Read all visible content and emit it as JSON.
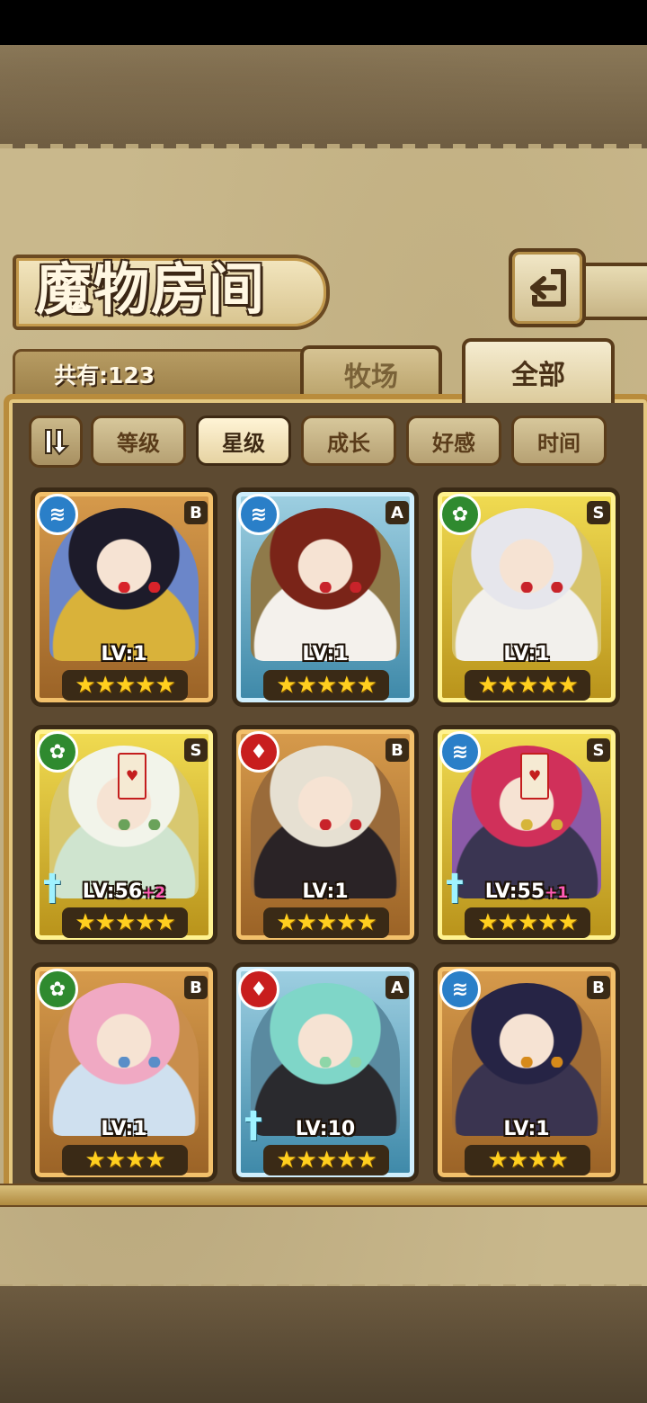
{
  "header": {
    "title": "魔物房间",
    "back_icon": "back-arrow-icon"
  },
  "summary": {
    "count_label": "共有:123"
  },
  "tabs": [
    {
      "label": "牧场",
      "active": false
    },
    {
      "label": "全部",
      "active": true
    }
  ],
  "sort": {
    "toggle_icon": "sort-order-icon",
    "buttons": [
      {
        "label": "等级",
        "active": false
      },
      {
        "label": "星级",
        "active": true
      },
      {
        "label": "成长",
        "active": false
      },
      {
        "label": "好感",
        "active": false
      },
      {
        "label": "时间",
        "active": false
      }
    ]
  },
  "cards": [
    {
      "element": "water",
      "rank": "B",
      "frame": "bronze",
      "level": "LV:1",
      "plus": "",
      "stars": 5,
      "hair": "#1d1b2a",
      "eye": "#d8232a",
      "cloth": "#d9b23a",
      "bg": "#6b86c9"
    },
    {
      "element": "water",
      "rank": "A",
      "frame": "silver",
      "level": "LV:1",
      "plus": "",
      "stars": 5,
      "hair": "#7a2418",
      "eye": "#c8232a",
      "cloth": "#f4f1ec",
      "bg": "#8f7a4a"
    },
    {
      "element": "grass",
      "rank": "S",
      "frame": "gold",
      "level": "LV:1",
      "plus": "",
      "stars": 5,
      "hair": "#e6e6ec",
      "eye": "#c8232a",
      "cloth": "#f2f0ec",
      "bg": "#d6c36c"
    },
    {
      "element": "grass",
      "rank": "S",
      "frame": "gold",
      "level": "LV:56",
      "plus": "+2",
      "stars": 5,
      "hair": "#f2f4ea",
      "eye": "#6aa25a",
      "cloth": "#cfe4cf",
      "bg": "#d8c870",
      "weapon": true,
      "sealed": true
    },
    {
      "element": "fire",
      "rank": "B",
      "frame": "bronze",
      "level": "LV:1",
      "plus": "",
      "stars": 5,
      "hair": "#e6e0d2",
      "eye": "#c8232a",
      "cloth": "#2a2326",
      "bg": "#9a6b3a"
    },
    {
      "element": "water",
      "rank": "S",
      "frame": "gold",
      "level": "LV:55",
      "plus": "+1",
      "stars": 5,
      "hair": "#d0305a",
      "eye": "#d6b53a",
      "cloth": "#3a3552",
      "bg": "#8b5aa8",
      "weapon": true,
      "sealed": true
    },
    {
      "element": "grass",
      "rank": "B",
      "frame": "bronze",
      "level": "LV:1",
      "plus": "",
      "stars": 4,
      "hair": "#f0a9c3",
      "eye": "#5a8ec8",
      "cloth": "#cfe0ef",
      "bg": "#c98e4c"
    },
    {
      "element": "fire",
      "rank": "A",
      "frame": "silver",
      "level": "LV:10",
      "plus": "",
      "stars": 5,
      "hair": "#7fd6c8",
      "eye": "#8ed6a8",
      "cloth": "#2a2a2e",
      "bg": "#5a8aa0",
      "weapon": true
    },
    {
      "element": "water",
      "rank": "B",
      "frame": "bronze",
      "level": "LV:1",
      "plus": "",
      "stars": 4,
      "hair": "#262445",
      "eye": "#d68a1a",
      "cloth": "#3a3450",
      "bg": "#a06c36"
    }
  ],
  "element_glyphs": {
    "water": "≋",
    "fire": "♦",
    "grass": "✿"
  },
  "colors": {
    "panel": "#c9b88c",
    "board": "#5d4a31",
    "frame_outline": "#3a2a16",
    "star": "#ffcf1f",
    "plus": "#ff5ab4"
  }
}
